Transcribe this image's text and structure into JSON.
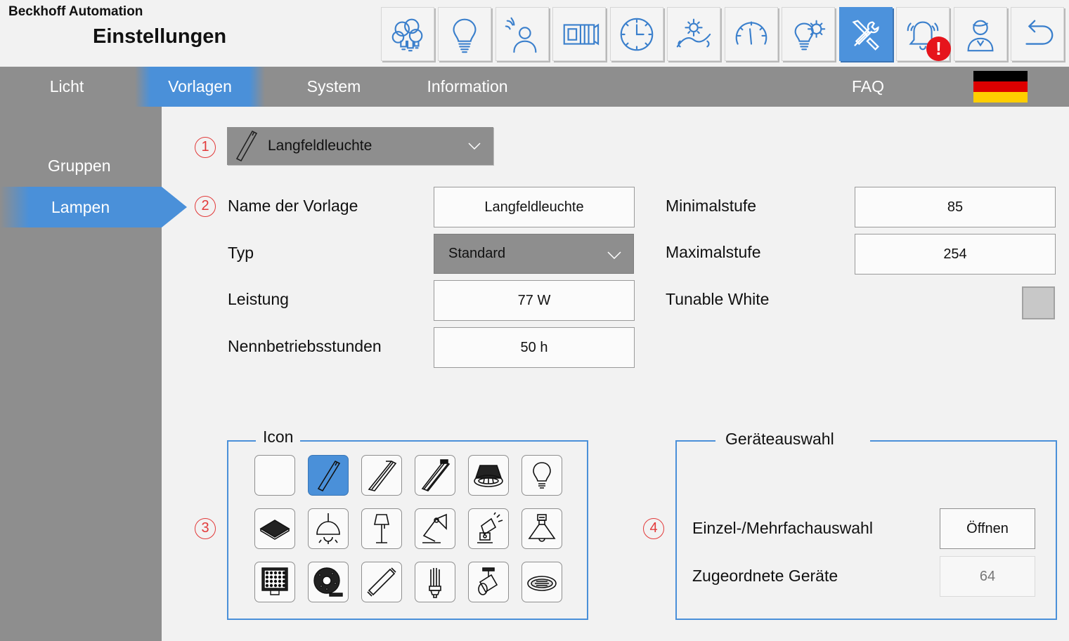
{
  "header": {
    "brand": "Beckhoff Automation",
    "title": "Einstellungen",
    "toolbar": [
      {
        "icon": "light-bulbs-group-icon"
      },
      {
        "icon": "light-bulb-icon"
      },
      {
        "icon": "presence-sensor-icon"
      },
      {
        "icon": "blinds-icon"
      },
      {
        "icon": "clock-icon"
      },
      {
        "icon": "daylight-icon"
      },
      {
        "icon": "gauge-icon"
      },
      {
        "icon": "light-settings-icon"
      },
      {
        "icon": "tools-icon",
        "active": true
      },
      {
        "icon": "alarm-bell-icon",
        "badge": "!"
      },
      {
        "icon": "user-icon"
      },
      {
        "icon": "back-icon"
      }
    ]
  },
  "nav": {
    "tabs": [
      {
        "label": "Licht"
      },
      {
        "label": "Vorlagen",
        "active": true
      },
      {
        "label": "System"
      },
      {
        "label": "Information"
      },
      {
        "label": "FAQ"
      }
    ],
    "language_flag": "de-flag-icon"
  },
  "sidebar": {
    "items": [
      {
        "label": "Gruppen"
      },
      {
        "label": "Lampen",
        "active": true
      }
    ]
  },
  "markers": [
    "1",
    "2",
    "3",
    "4"
  ],
  "template_select": {
    "value": "Langfeldleuchte",
    "icon": "linear-luminaire-icon"
  },
  "fields": {
    "name_label": "Name der Vorlage",
    "name_value": "Langfeldleuchte",
    "type_label": "Typ",
    "type_value": "Standard",
    "power_label": "Leistung",
    "power_value": "77 W",
    "hours_label": "Nennbetriebsstunden",
    "hours_value": "50 h",
    "min_label": "Minimalstufe",
    "min_value": "85",
    "max_label": "Maximalstufe",
    "max_value": "254",
    "tunable_label": "Tunable White",
    "tunable_checked": false
  },
  "icon_group": {
    "title": "Icon",
    "icons": [
      "empty-icon",
      "linear-luminaire-icon",
      "batten-luminaire-icon",
      "twin-batten-icon",
      "downlight-icon",
      "bulb-icon",
      "panel-light-icon",
      "pendant-lamp-icon",
      "floor-lamp-icon",
      "desk-lamp-icon",
      "spotlight-icon",
      "high-bay-icon",
      "led-matrix-icon",
      "led-strip-icon",
      "tube-lamp-icon",
      "cfl-lamp-icon",
      "track-spot-icon",
      "recessed-light-icon"
    ],
    "selected_index": 1
  },
  "device_group": {
    "title": "Geräteauswahl",
    "select_label": "Einzel-/Mehrfachauswahl",
    "open_button": "Öffnen",
    "assigned_label": "Zugeordnete Geräte",
    "assigned_value": "64"
  },
  "colors": {
    "accent": "#4a90d9",
    "bar_gray": "#8e8e8e",
    "marker_red": "#e23a3a",
    "alarm_red": "#e6141c"
  }
}
